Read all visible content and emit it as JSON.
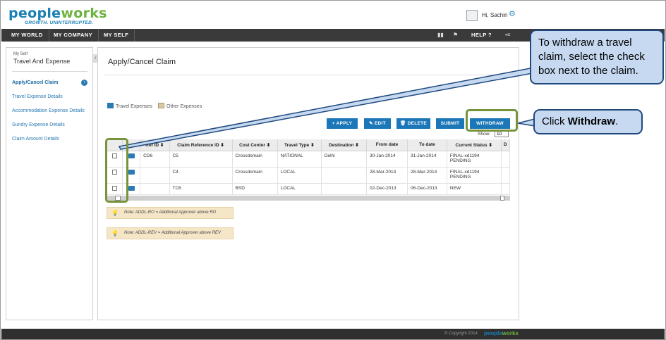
{
  "header": {
    "logo_text_a": "pe",
    "logo_text_b": "ople",
    "logo_text_c": "w",
    "logo_text_d": "orks",
    "tagline": "GROWTH. UNINTERRUPTED.",
    "greeting": "Hi, Sachin"
  },
  "nav": {
    "items": [
      "MY WORLD",
      "MY COMPANY",
      "MY SELF"
    ],
    "help": "HELP"
  },
  "sidebar": {
    "section_small": "My Self",
    "section_title": "Travel And Expense",
    "items": [
      "Apply/Cancel Claim",
      "Travel Expense Details",
      "Accommodation Expense Details",
      "Sundry Expense Details",
      "Claim Amount Details"
    ]
  },
  "main": {
    "title": "Apply/Cancel Claim",
    "tabs": [
      "Travel Expenses",
      "Other Expenses"
    ],
    "buttons": {
      "apply": "+ APPLY",
      "edit": "EDIT",
      "delete": "DELETE",
      "submit": "SUBMIT",
      "withdraw": "WITHDRAW"
    },
    "show_label": "Show:",
    "show_value": "10",
    "columns": [
      "Ref ID",
      "Claim Reference ID",
      "Cost Center",
      "Travel Type",
      "Destination",
      "From date",
      "To date",
      "Current Status",
      "D"
    ],
    "rows": [
      {
        "ref_id": "CD6",
        "claim_ref": "C5",
        "cost_center": "Crossdomain",
        "travel_type": "NATIONAL",
        "destination": "Delhi",
        "from": "30-Jan-2014",
        "to": "31-Jan-2014",
        "status_1": "FINAL-xd1194",
        "status_2": "PENDING"
      },
      {
        "ref_id": "",
        "claim_ref": "C4",
        "cost_center": "Crossdomain",
        "travel_type": "LOCAL",
        "destination": "",
        "from": "28-Mar-2014",
        "to": "28-Mar-2014",
        "status_1": "FINAL-xd1194",
        "status_2": "PENDING"
      },
      {
        "ref_id": "",
        "claim_ref": "TC6",
        "cost_center": "BSD",
        "travel_type": "LOCAL",
        "destination": "",
        "from": "02-Dec-2013",
        "to": "06-Dec-2013",
        "status_1": "NEW",
        "status_2": ""
      }
    ],
    "notes": [
      "Note: ADDL-RO = Additional Approver above RO",
      "Note: ADDL-REV = Additional Approver above REV"
    ]
  },
  "footer": {
    "copyright": "© Copyright 2014",
    "logo_a": "people",
    "logo_b": "works"
  },
  "annotations": {
    "callout_check": "To withdraw a travel claim, select the check box next to the claim.",
    "callout_withdraw_prefix": "Click ",
    "callout_withdraw_bold": "Withdraw",
    "callout_withdraw_suffix": "."
  },
  "colors": {
    "brand_blue": "#1a7fb5",
    "brand_green": "#6cb33f",
    "button_blue": "#1c77b9",
    "highlight_green": "#77933c",
    "callout_fill": "#c6d9f1",
    "callout_border": "#1f497d"
  },
  "icons": [
    "settings-icon",
    "briefcase-icon",
    "document-icon",
    "pencil-icon",
    "trash-icon",
    "help-icon",
    "bulb-icon",
    "flag-icon",
    "book-icon",
    "menu-icon",
    "chevron-right-icon"
  ]
}
